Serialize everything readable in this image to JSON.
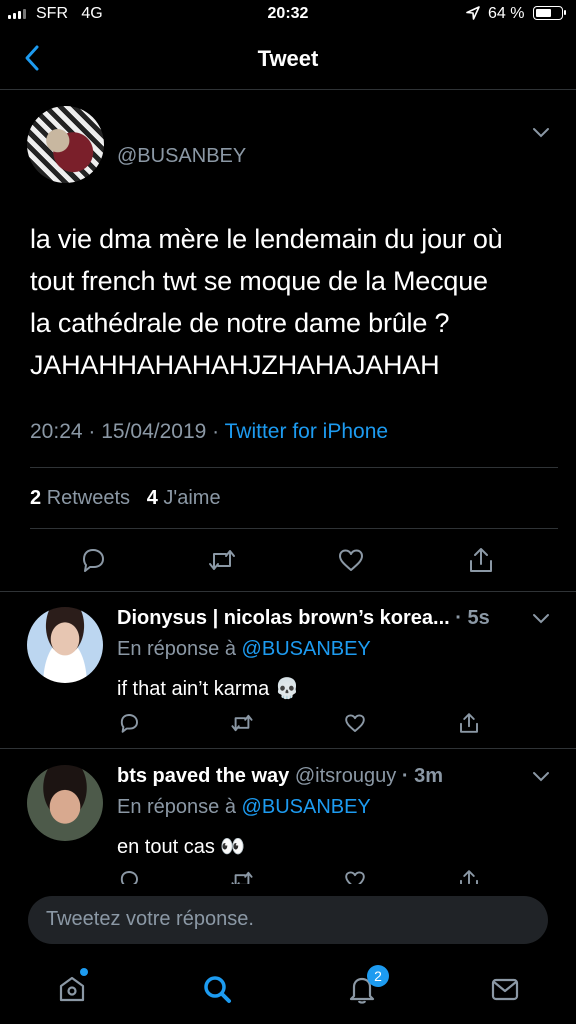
{
  "status_bar": {
    "carrier": "SFR",
    "network": "4G",
    "time": "20:32",
    "battery": "64 %",
    "battery_level": 0.64
  },
  "header": {
    "title": "Tweet",
    "back_icon": "chevron-left-icon"
  },
  "tweet": {
    "handle": "@BUSANBEY",
    "text_lines": [
      "la vie dma mère le lendemain du jour où",
      "tout french twt se moque de la Mecque",
      "la cathédrale de notre dame brûle ?",
      "JAHAHHAHAHAHJZHAHAJAHAH"
    ],
    "time": "20:24",
    "date": "15/04/2019",
    "source": "Twitter for iPhone",
    "retweets_count": "2",
    "retweets_label": "Retweets",
    "likes_count": "4",
    "likes_label": "J'aime"
  },
  "replies": [
    {
      "name": "Dionysus | nicolas brown’s korea...",
      "handle": "",
      "time": "· 5s",
      "reply_to_label": "En réponse à",
      "reply_to_handle": "@BUSANBEY",
      "text": "if that ain’t karma 💀"
    },
    {
      "name": "bts paved the way",
      "handle": "@itsrouguy",
      "time": "· 3m",
      "reply_to_label": "En réponse à",
      "reply_to_handle": "@BUSANBEY",
      "text": "en tout cas 👀"
    }
  ],
  "composer": {
    "placeholder": "Tweetez votre réponse."
  },
  "tab_bar": {
    "items": [
      "home-icon",
      "search-icon",
      "notifications-icon",
      "messages-icon"
    ],
    "notification_badge": "2"
  },
  "colors": {
    "accent": "#1d9bf0",
    "muted": "#8b98a5",
    "background": "#000000",
    "divider": "#2f3336"
  }
}
